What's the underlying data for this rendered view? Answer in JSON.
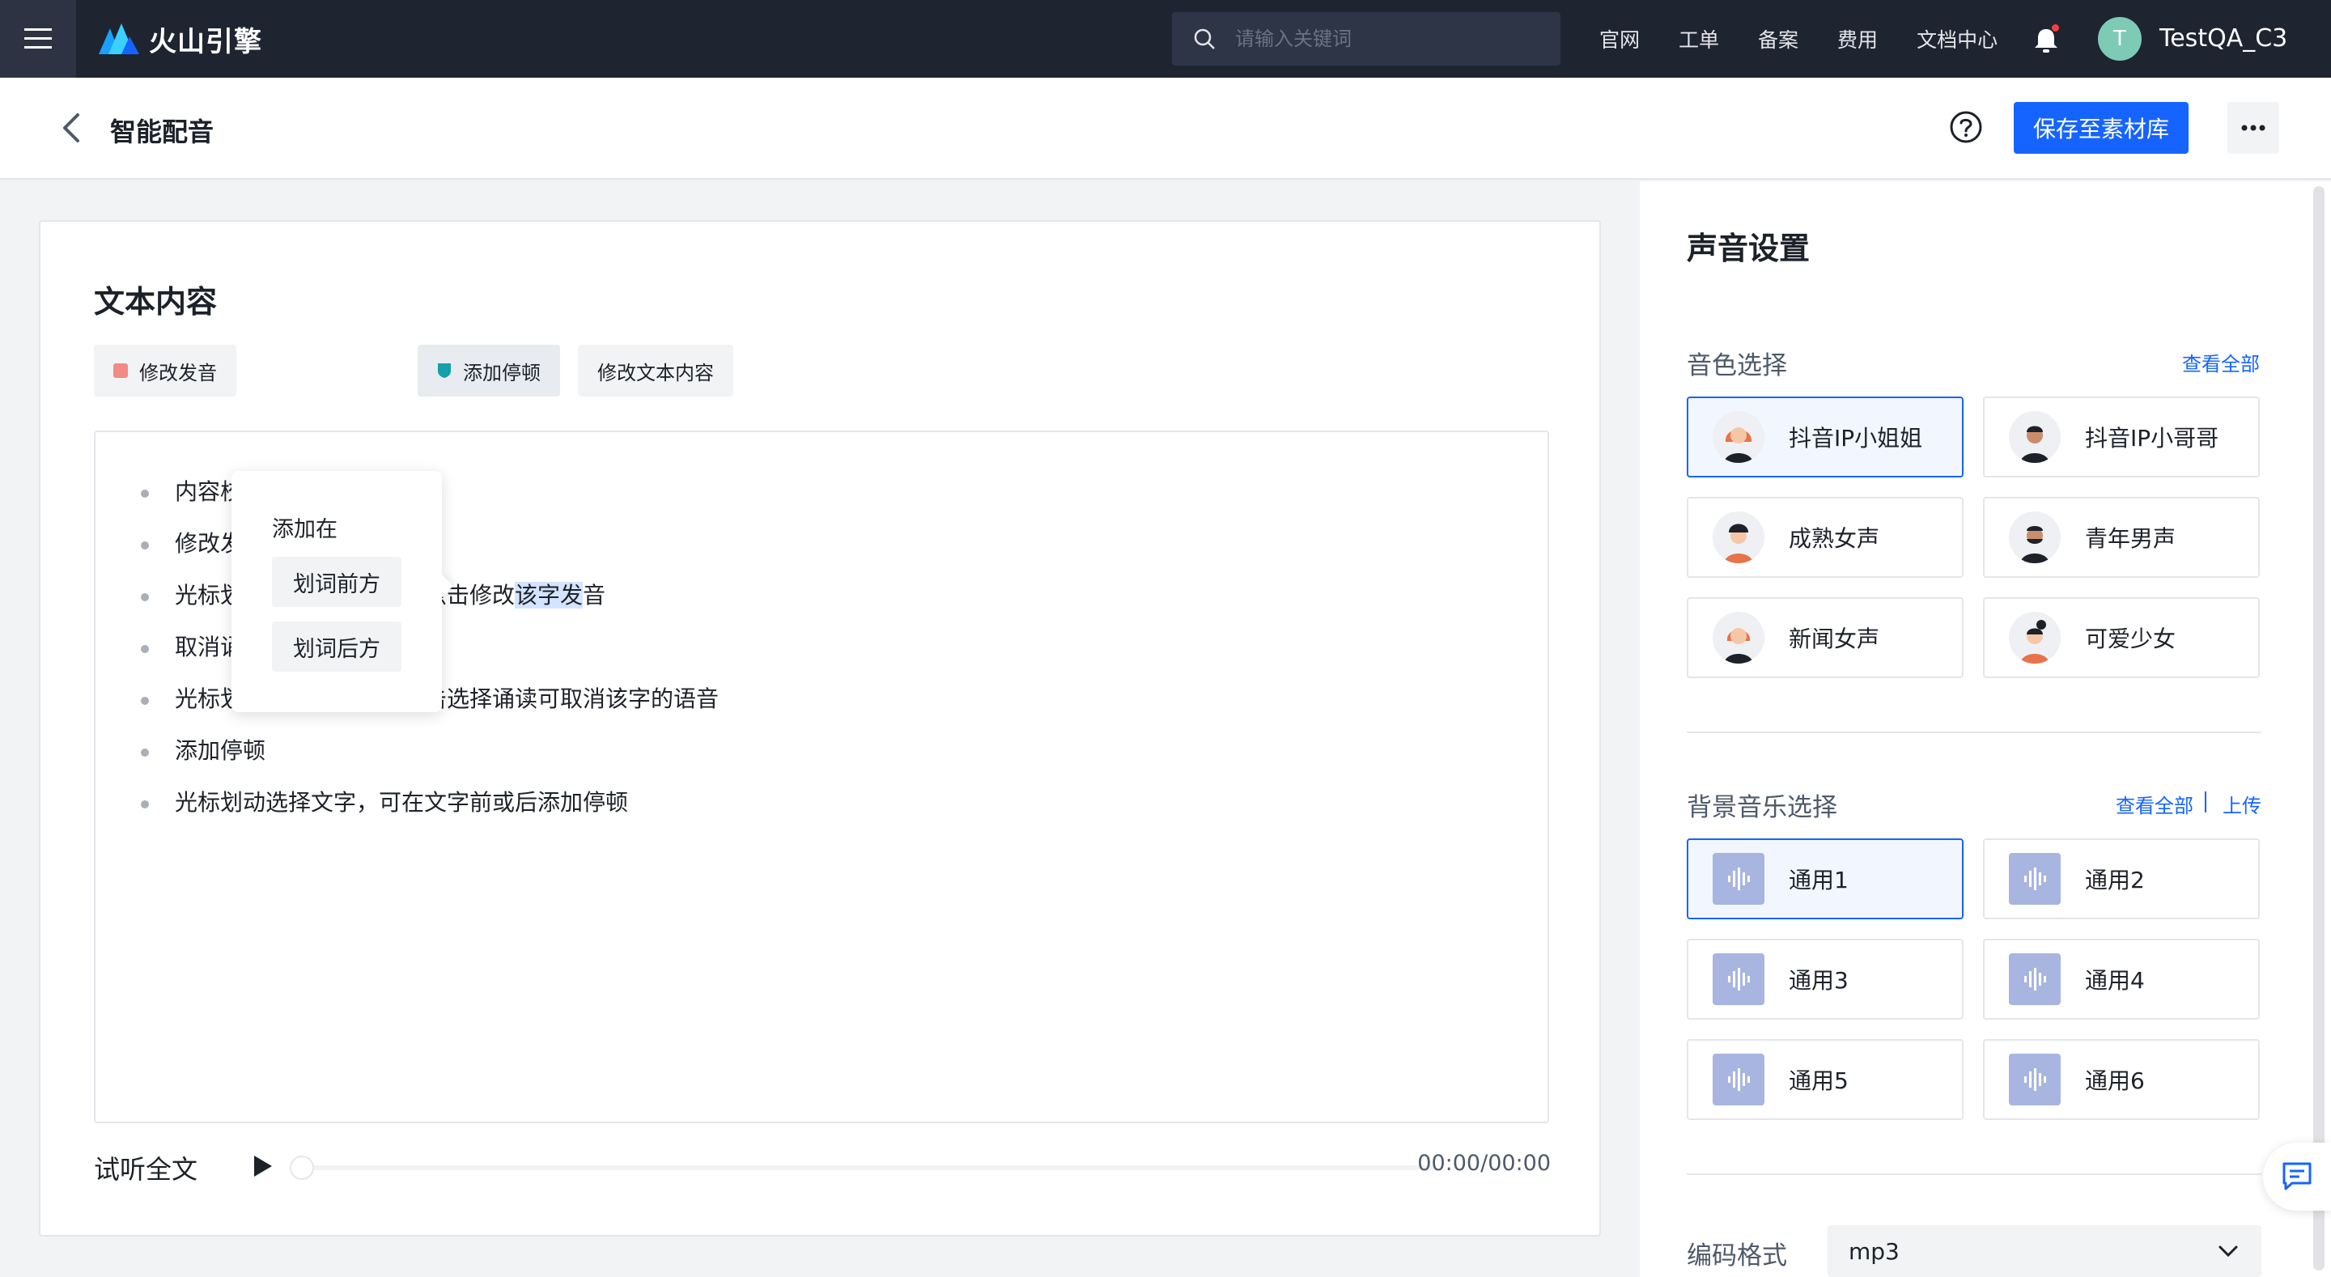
{
  "topbar": {
    "brand": "火山引擎",
    "search_placeholder": "请输入关键词",
    "links": [
      "官网",
      "工单",
      "备案",
      "费用",
      "文档中心"
    ],
    "user_initial": "T",
    "username": "TestQA_C3"
  },
  "subheader": {
    "title": "智能配音",
    "save_label": "保存至素材库"
  },
  "editor": {
    "title": "文本内容",
    "tools": {
      "modify_pron": "修改发音",
      "add_pause": "添加停顿",
      "modify_text": "修改文本内容"
    },
    "popover": {
      "title": "添加在",
      "before": "划词前方",
      "after": "划词后方"
    },
    "lines": {
      "l0": "内容校正",
      "l1": "修改发音",
      "l2_pre": "光标划动单选一个字，可点击修改",
      "l2_hl": "该字发",
      "l2_post": "音",
      "l3": "取消诵读",
      "l4": "光标划动单选一个字，点击选择诵读可取消该字的语音",
      "l5": "添加停顿",
      "l6": "光标划动选择文字，可在文字前或后添加停顿"
    },
    "listen_label": "试听全文",
    "time": "00:00/00:00"
  },
  "side": {
    "title": "声音设置",
    "voice_section": "音色选择",
    "view_all": "查看全部",
    "voices": [
      {
        "name": "抖音IP小姐姐"
      },
      {
        "name": "抖音IP小哥哥"
      },
      {
        "name": "成熟女声"
      },
      {
        "name": "青年男声"
      },
      {
        "name": "新闻女声"
      },
      {
        "name": "可爱少女"
      }
    ],
    "music_section": "背景音乐选择",
    "upload": "上传",
    "music": [
      {
        "name": "通用1"
      },
      {
        "name": "通用2"
      },
      {
        "name": "通用3"
      },
      {
        "name": "通用4"
      },
      {
        "name": "通用5"
      },
      {
        "name": "通用6"
      }
    ],
    "format_label": "编码格式",
    "format_value": "mp3"
  },
  "colors": {
    "primary": "#1664ff",
    "topbar_bg": "#1f2431",
    "pron_marker": "#f28b82",
    "pause_marker": "#14a0a8"
  }
}
